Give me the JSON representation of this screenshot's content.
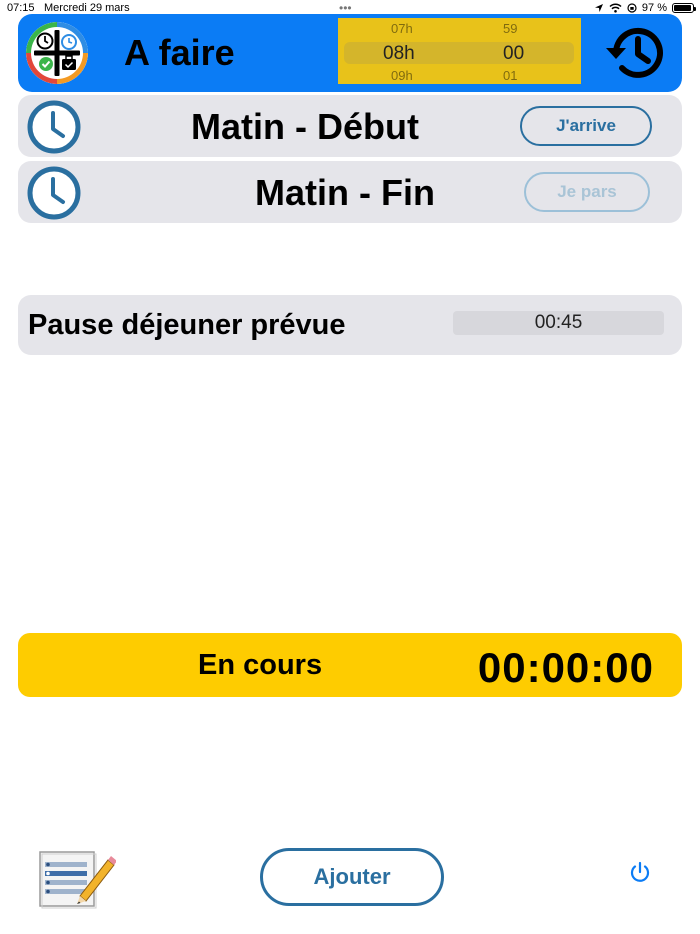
{
  "status_bar": {
    "time": "07:15",
    "date": "Mercredi 29 mars",
    "battery": "97 %",
    "battery_level": 0.97
  },
  "header": {
    "title": "A faire",
    "picker": {
      "hour_prev": "07h",
      "hour_selected": "08h",
      "hour_next": "09h",
      "minute_prev": "59",
      "minute_selected": "00",
      "minute_next": "01"
    }
  },
  "tasks": [
    {
      "label": "Matin - Début",
      "button": "J'arrive",
      "enabled": true
    },
    {
      "label": "Matin - Fin",
      "button": "Je pars",
      "enabled": false
    }
  ],
  "pause": {
    "label": "Pause déjeuner prévue",
    "value": "00:45"
  },
  "progress": {
    "status": "En cours",
    "timer": "00:00:00"
  },
  "footer": {
    "add_label": "Ajouter"
  },
  "colors": {
    "header_bg": "#0b7cf5",
    "picker_bg": "#e8c21a",
    "row_bg": "#e5e5ea",
    "accent": "#2a6fa0",
    "progress_bg": "#fecc00",
    "power_icon": "#0b7cf5"
  },
  "icons": {
    "app_logo": "app-logo-icon",
    "history": "history-icon",
    "clock": "clock-icon",
    "list": "list-edit-icon",
    "power": "power-icon",
    "location": "location-arrow-icon",
    "wifi": "wifi-icon",
    "battery": "battery-icon"
  }
}
